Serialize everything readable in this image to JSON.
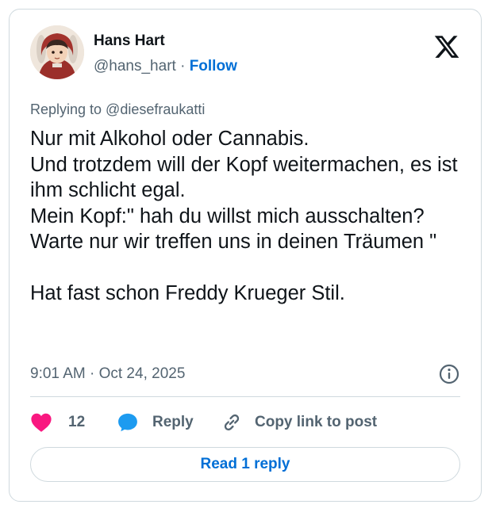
{
  "author": {
    "name": "Hans Hart",
    "handle": "@hans_hart",
    "separator": "·",
    "follow_label": "Follow"
  },
  "replying_to": "Replying to @diesefraukatti",
  "post_text": "Nur mit Alkohol oder Cannabis.\nUnd trotzdem will der Kopf weitermachen, es ist ihm schlicht egal.\nMein Kopf:\" hah du willst mich ausschalten?Warte nur wir treffen uns in deinen Träumen \"\n\nHat fast schon Freddy Krueger Stil.",
  "timestamp": "9:01 AM · Oct 24, 2025",
  "actions": {
    "like_count": "12",
    "reply_label": "Reply",
    "copy_label": "Copy link to post"
  },
  "read_replies_label": "Read 1 reply",
  "icons": {
    "logo": "x-logo-icon",
    "info": "info-icon",
    "like": "heart-icon",
    "reply": "speech-bubble-icon",
    "copy": "link-icon"
  },
  "colors": {
    "accent": "#006fd6",
    "like": "#f91880",
    "reply_icon": "#1d9bf0",
    "text": "#0f1419",
    "muted": "#536471",
    "border": "#cfd9de"
  }
}
